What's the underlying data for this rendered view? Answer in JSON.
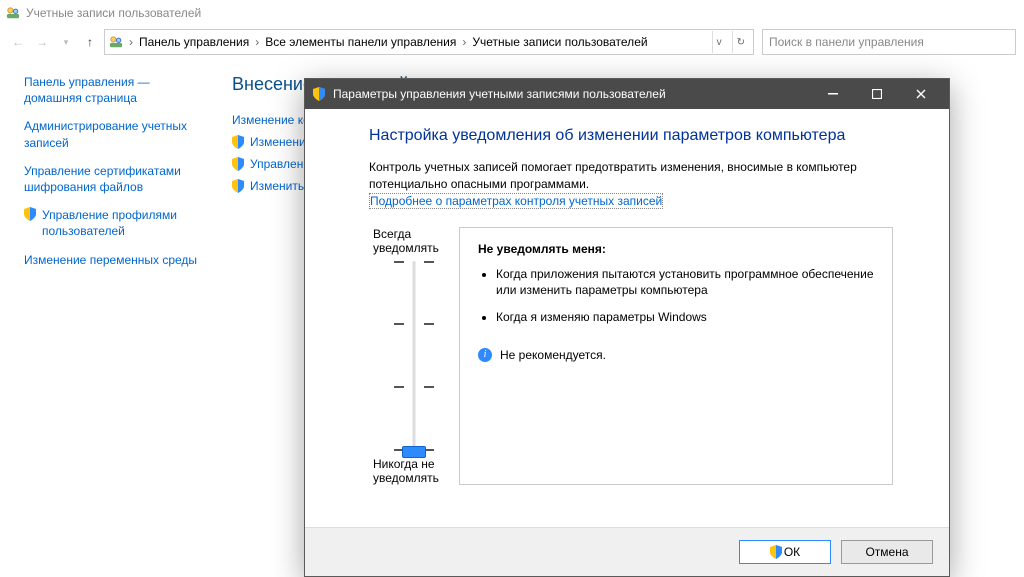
{
  "cp": {
    "window_title": "Учетные записи пользователей",
    "breadcrumbs": [
      "Панель управления",
      "Все элементы панели управления",
      "Учетные записи пользователей"
    ],
    "search_placeholder": "Поиск в панели управления",
    "sidebar": [
      "Панель управления — домашняя страница",
      "Администрирование учетных записей",
      "Управление сертификатами шифрования файлов",
      "Управление профилями пользователей",
      "Изменение переменных среды"
    ],
    "main_heading": "Внесение изменений в учетную запись пользователя",
    "main_links": [
      "Изменение компьютера",
      "Изменение",
      "Управление",
      "Изменить п"
    ]
  },
  "dlg": {
    "title": "Параметры управления учетными записями пользователей",
    "heading": "Настройка уведомления об изменении параметров компьютера",
    "paragraph": "Контроль учетных записей помогает предотвратить изменения, вносимые в компьютер потенциально опасными программами.",
    "more_link": "Подробнее о параметрах контроля учетных записей",
    "slider_top": "Всегда уведомлять",
    "slider_bottom": "Никогда не уведомлять",
    "desc_heading": "Не уведомлять меня:",
    "desc_items": [
      "Когда приложения пытаются установить программное обеспечение или изменить параметры компьютера",
      "Когда я изменяю параметры Windows"
    ],
    "not_recommended": "Не рекомендуется.",
    "ok": "ОК",
    "cancel": "Отмена"
  }
}
